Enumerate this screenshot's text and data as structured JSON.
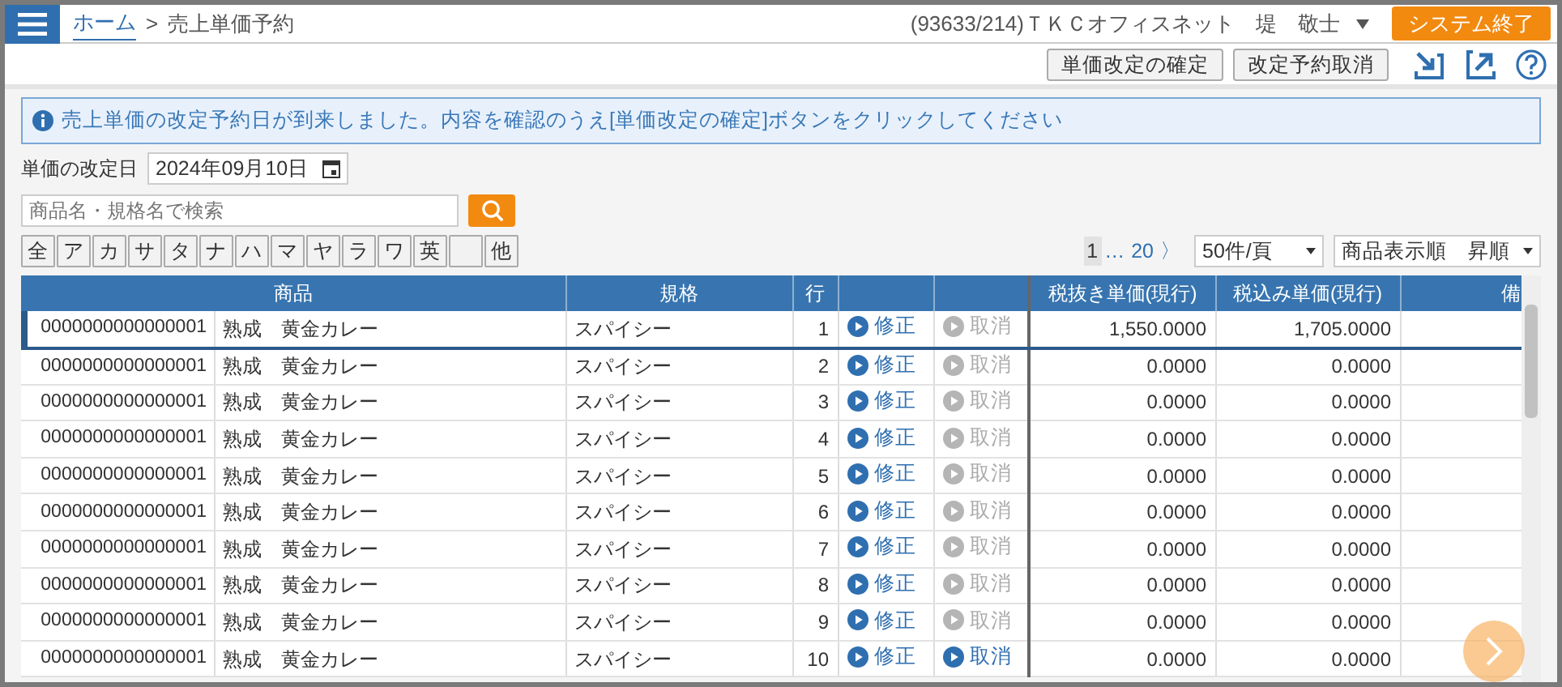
{
  "breadcrumb": [
    {
      "label": "ホーム",
      "link": true
    },
    {
      "label": "売上単価予約",
      "link": false
    }
  ],
  "breadcrumb_separator": ">",
  "user": "(93633/214)ＴＫＣオフィスネット　堤　敬士",
  "exit_button": "システム終了",
  "toolbar_buttons": [
    "単価改定の確定",
    "改定予約取消"
  ],
  "info_message": "売上単価の改定予約日が到来しました。内容を確認のうえ[単価改定の確定]ボタンをクリックしてください",
  "date_field": {
    "label": "単価の改定日",
    "value": "2024年09月10日"
  },
  "search": {
    "placeholder": "商品名・規格名で検索"
  },
  "kana_keys": [
    {
      "kind": "key",
      "label": "全"
    },
    {
      "kind": "key",
      "label": "ア"
    },
    {
      "kind": "key",
      "label": "カ"
    },
    {
      "kind": "key",
      "label": "サ"
    },
    {
      "kind": "key",
      "label": "タ"
    },
    {
      "kind": "key",
      "label": "ナ"
    },
    {
      "kind": "key",
      "label": "ハ"
    },
    {
      "kind": "key",
      "label": "マ"
    },
    {
      "kind": "key",
      "label": "ヤ"
    },
    {
      "kind": "key",
      "label": "ラ"
    },
    {
      "kind": "key",
      "label": "ワ"
    },
    {
      "kind": "key",
      "label": "英"
    },
    {
      "kind": "blank"
    },
    {
      "kind": "key",
      "label": "他"
    }
  ],
  "pagination": {
    "pages": [
      {
        "label": "1",
        "selected": true
      },
      {
        "label": "…",
        "selected": false
      },
      {
        "label": "20",
        "selected": false
      }
    ],
    "next": "〉"
  },
  "per_page": "50件/頁",
  "sort": "商品表示順　昇順",
  "table": {
    "columns": [
      "商品",
      "規格",
      "行",
      "",
      "",
      "税抜き単価(現行)",
      "税込み単価(現行)",
      "備"
    ],
    "rows": [
      {
        "code": "0000000000000001",
        "name": "熟成　黄金カレー",
        "spec": "スパイシー",
        "line": "1",
        "edit": "修正",
        "cancel": "取消",
        "cancel_disabled": true,
        "price_ex": "1,550.0000",
        "price_in": "1,705.0000",
        "selected": true
      },
      {
        "code": "0000000000000001",
        "name": "熟成　黄金カレー",
        "spec": "スパイシー",
        "line": "2",
        "edit": "修正",
        "cancel": "取消",
        "cancel_disabled": true,
        "price_ex": "0.0000",
        "price_in": "0.0000",
        "selected": false
      },
      {
        "code": "0000000000000001",
        "name": "熟成　黄金カレー",
        "spec": "スパイシー",
        "line": "3",
        "edit": "修正",
        "cancel": "取消",
        "cancel_disabled": true,
        "price_ex": "0.0000",
        "price_in": "0.0000",
        "selected": false
      },
      {
        "code": "0000000000000001",
        "name": "熟成　黄金カレー",
        "spec": "スパイシー",
        "line": "4",
        "edit": "修正",
        "cancel": "取消",
        "cancel_disabled": true,
        "price_ex": "0.0000",
        "price_in": "0.0000",
        "selected": false
      },
      {
        "code": "0000000000000001",
        "name": "熟成　黄金カレー",
        "spec": "スパイシー",
        "line": "5",
        "edit": "修正",
        "cancel": "取消",
        "cancel_disabled": true,
        "price_ex": "0.0000",
        "price_in": "0.0000",
        "selected": false
      },
      {
        "code": "0000000000000001",
        "name": "熟成　黄金カレー",
        "spec": "スパイシー",
        "line": "6",
        "edit": "修正",
        "cancel": "取消",
        "cancel_disabled": true,
        "price_ex": "0.0000",
        "price_in": "0.0000",
        "selected": false
      },
      {
        "code": "0000000000000001",
        "name": "熟成　黄金カレー",
        "spec": "スパイシー",
        "line": "7",
        "edit": "修正",
        "cancel": "取消",
        "cancel_disabled": true,
        "price_ex": "0.0000",
        "price_in": "0.0000",
        "selected": false
      },
      {
        "code": "0000000000000001",
        "name": "熟成　黄金カレー",
        "spec": "スパイシー",
        "line": "8",
        "edit": "修正",
        "cancel": "取消",
        "cancel_disabled": true,
        "price_ex": "0.0000",
        "price_in": "0.0000",
        "selected": false
      },
      {
        "code": "0000000000000001",
        "name": "熟成　黄金カレー",
        "spec": "スパイシー",
        "line": "9",
        "edit": "修正",
        "cancel": "取消",
        "cancel_disabled": true,
        "price_ex": "0.0000",
        "price_in": "0.0000",
        "selected": false
      },
      {
        "code": "0000000000000001",
        "name": "熟成　黄金カレー",
        "spec": "スパイシー",
        "line": "10",
        "edit": "修正",
        "cancel": "取消",
        "cancel_disabled": false,
        "price_ex": "0.0000",
        "price_in": "0.0000",
        "selected": false
      }
    ]
  }
}
